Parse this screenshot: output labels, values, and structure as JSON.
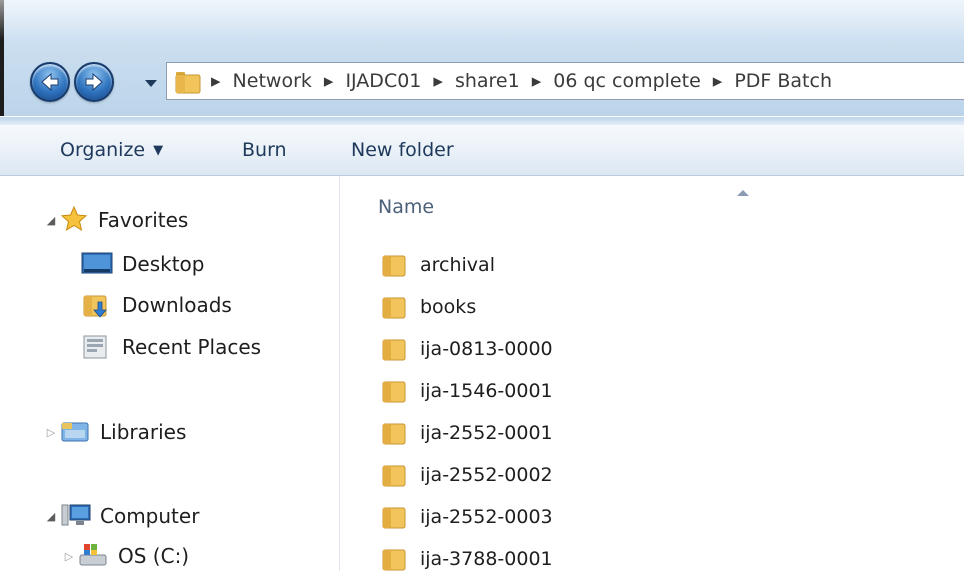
{
  "address": {
    "crumbs": [
      "Network",
      "IJADC01",
      "share1",
      "06 qc complete",
      "PDF Batch"
    ]
  },
  "toolbar": {
    "organize_label": "Organize",
    "burn_label": "Burn",
    "new_folder_label": "New folder"
  },
  "nav": {
    "favorites_label": "Favorites",
    "desktop_label": "Desktop",
    "downloads_label": "Downloads",
    "recent_label": "Recent Places",
    "libraries_label": "Libraries",
    "computer_label": "Computer",
    "os_drive_label": "OS (C:)"
  },
  "content": {
    "name_column_label": "Name",
    "items": [
      "archival",
      "books",
      "ija-0813-0000",
      "ija-1546-0001",
      "ija-2552-0001",
      "ija-2552-0002",
      "ija-2552-0003",
      "ija-3788-0001"
    ]
  },
  "colors": {
    "toolbar_text": "#1e395b",
    "folder": "#f2c55c",
    "chrome": "#c9ddef"
  }
}
